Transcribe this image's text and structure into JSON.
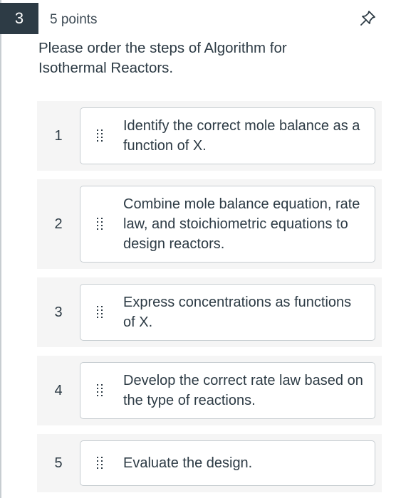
{
  "question": {
    "number": "3",
    "points": "5 points",
    "prompt": "Please order the steps of Algorithm for Isothermal Reactors."
  },
  "icons": {
    "pin": "pin-icon",
    "drag": "drag-handle-icon"
  },
  "steps": [
    {
      "position": "1",
      "text": "Identify the correct mole balance as a function of X."
    },
    {
      "position": "2",
      "text": "Combine mole balance equation, rate law, and stoichiometric equations to design reactors."
    },
    {
      "position": "3",
      "text": "Express concentrations as functions of X."
    },
    {
      "position": "4",
      "text": "Develop the correct rate law based on the type of reactions."
    },
    {
      "position": "5",
      "text": "Evaluate the design."
    }
  ]
}
